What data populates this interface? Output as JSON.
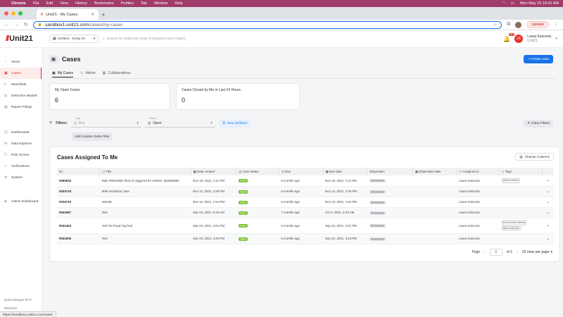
{
  "macbar": {
    "app": "Chrome",
    "menus": [
      "File",
      "Edit",
      "View",
      "History",
      "Bookmarks",
      "Profiles",
      "Tab",
      "Window",
      "Help"
    ],
    "clock": "Mon May 15 10:41 AM"
  },
  "browser": {
    "tab_title": "Unit21 - My Cases",
    "url_host": "sandbox1.unit21.com",
    "url_path": "/cases/my-cases",
    "update_label": "Update",
    "status_url": "https://sandbox1.unit21.com/cases"
  },
  "header": {
    "logo": "Unit21",
    "entity_select": "Entities - Entity ID",
    "search_placeholder": "Search for entities by entity id (requires exact match)",
    "notif_count": "99+",
    "avatar_initials": "LK",
    "user_name": "Laura Kasovsic",
    "user_org": "Unit21"
  },
  "sidebar": {
    "items": [
      {
        "label": "Alerts",
        "icon": "bell-icon"
      },
      {
        "label": "Cases",
        "icon": "briefcase-icon"
      },
      {
        "label": "Matchlists",
        "icon": "list-icon"
      },
      {
        "label": "Detection Models",
        "icon": "target-icon"
      },
      {
        "label": "Report Filings",
        "icon": "document-icon"
      },
      {
        "label": "Dashboards",
        "icon": "dashboard-icon"
      },
      {
        "label": "Data Explorer",
        "icon": "database-icon"
      },
      {
        "label": "Risk Scores",
        "icon": "shield-icon"
      },
      {
        "label": "Verifications",
        "icon": "check-icon"
      },
      {
        "label": "System",
        "icon": "gear-icon"
      },
      {
        "label": "Admin Dashboard",
        "icon": "admin-icon"
      }
    ],
    "quick_navigate": "Quick Navigate ⌘+K",
    "minimize": "Minimize"
  },
  "page": {
    "title": "Cases",
    "create_label": "+ Create case",
    "tabs": [
      "My Cases",
      "Admin",
      "Collaborations"
    ],
    "stats": [
      {
        "label": "My Open Cases",
        "value": "6"
      },
      {
        "label": "Cases Closed by Me in Last 24 Hours",
        "value": "0"
      }
    ],
    "filters": {
      "label": "Filters:",
      "tags_caption": "Tags",
      "tags_value": "Any",
      "status_caption": "Status",
      "status_value": "Open",
      "view_all": "View all filters",
      "clear": "Clear Filters",
      "add_custom": "Add Custom Data Filter"
    }
  },
  "table": {
    "title": "Cases Assigned To Me",
    "choose_columns": "Choose Columns",
    "columns": [
      "ID",
      "Title",
      "Date created",
      "Case status",
      "Due",
      "Due date",
      "Disposition",
      "Disposition date",
      "Assigned to",
      "Tags"
    ],
    "rows": [
      {
        "id": "9360633",
        "title": "Rule #8934055 (Test 2) triggered for entities: 563355866",
        "created": "Nov 18, 2021, 1:41 PM",
        "status": "Open",
        "due": "6 months ago",
        "due_date": "Nov 19, 2021, 1:41 PM",
        "disposition": "Unresolved",
        "disposition_date": "",
        "assigned": "Laura Kasovsic",
        "tags": [
          "sender:warajer"
        ]
      },
      {
        "id": "9334719",
        "title": "Bulk resolution case",
        "created": "Nov 12, 2021, 2:25 PM",
        "status": "Open",
        "due": "6 months ago",
        "due_date": "Nov 13, 2021, 2:25 PM",
        "disposition": "Unresolved",
        "disposition_date": "",
        "assigned": "Laura Kasovsic",
        "tags": []
      },
      {
        "id": "9334710",
        "title": "Sample",
        "created": "Nov 12, 2021, 1:54 PM",
        "status": "Open",
        "due": "6 months ago",
        "due_date": "Nov 13, 2021, 1:54 PM",
        "disposition": "Unresolved",
        "disposition_date": "",
        "assigned": "Laura Kasovsic",
        "tags": []
      },
      {
        "id": "9041967",
        "title": "Test",
        "created": "Sep 24, 2021, 9:43 AM",
        "status": "Open",
        "due": "7 months ago",
        "due_date": "Oct 4, 2021, 9:43 AM",
        "disposition": "Unresolved",
        "disposition_date": "",
        "assigned": "Laura Kasovsic",
        "tags": []
      },
      {
        "id": "9041463",
        "title": "Alert for fraud ring fool",
        "created": "Sep 23, 2021, 4:01 PM",
        "status": "Open",
        "due": "8 months ago",
        "due_date": "Sep 24, 2021, 4:01 PM",
        "disposition": "Unresolved",
        "disposition_date": "",
        "assigned": "Laura Kasovsic",
        "tags": [
          "source:retail_internal",
          "Mass Rule:Bud"
        ]
      },
      {
        "id": "9041006",
        "title": "Test",
        "created": "Sep 23, 2021, 3:43 PM",
        "status": "Open",
        "due": "8 months ago",
        "due_date": "Sep 24, 2021, 3:43 PM",
        "disposition": "Unresolved",
        "disposition_date": "",
        "assigned": "Laura Kasovsic",
        "tags": []
      }
    ],
    "pager": {
      "page_label": "Page",
      "page": "1",
      "of_label": "of 1",
      "rows_per_page": "25 rows per page"
    }
  }
}
